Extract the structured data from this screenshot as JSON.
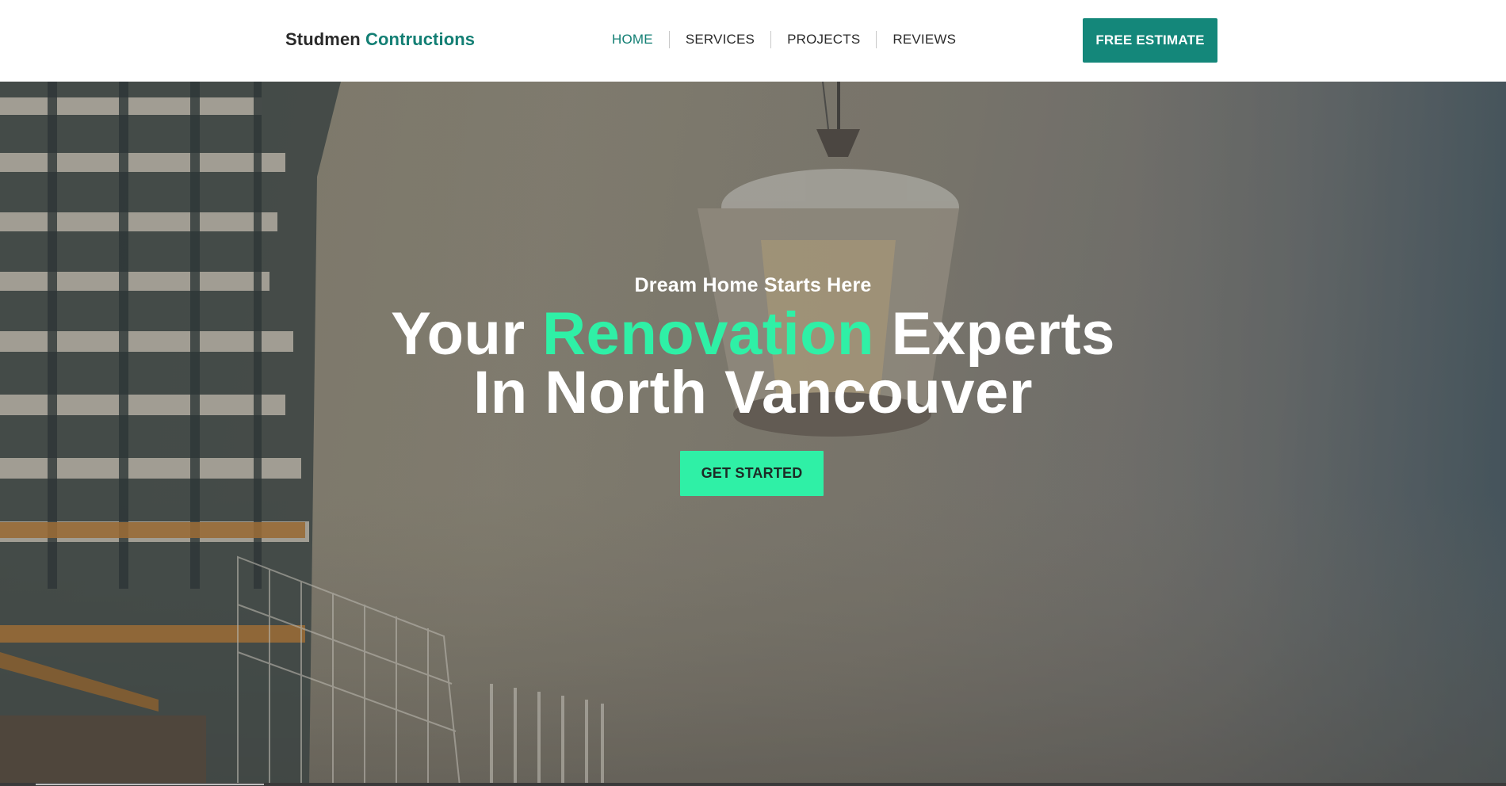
{
  "header": {
    "logo": {
      "part1": "Studmen",
      "part2": "Contructions"
    },
    "nav": [
      {
        "label": "HOME",
        "active": true
      },
      {
        "label": "SERVICES",
        "active": false
      },
      {
        "label": "PROJECTS",
        "active": false
      },
      {
        "label": "REVIEWS",
        "active": false
      }
    ],
    "cta_label": "FREE ESTIMATE"
  },
  "hero": {
    "tagline": "Dream Home Starts Here",
    "title": {
      "part1": "Your ",
      "highlight": "Renovation",
      "part2": " Experts",
      "line2": "In North Vancouver"
    },
    "cta_label": "GET STARTED",
    "background": "construction site video: concrete bucket lifted by crane beside high-rise building under construction"
  },
  "colors": {
    "brand_teal": "#137f74",
    "button_teal": "#14877a",
    "accent_mint": "#2ff0a6",
    "text_dark": "#2b2b2b"
  }
}
